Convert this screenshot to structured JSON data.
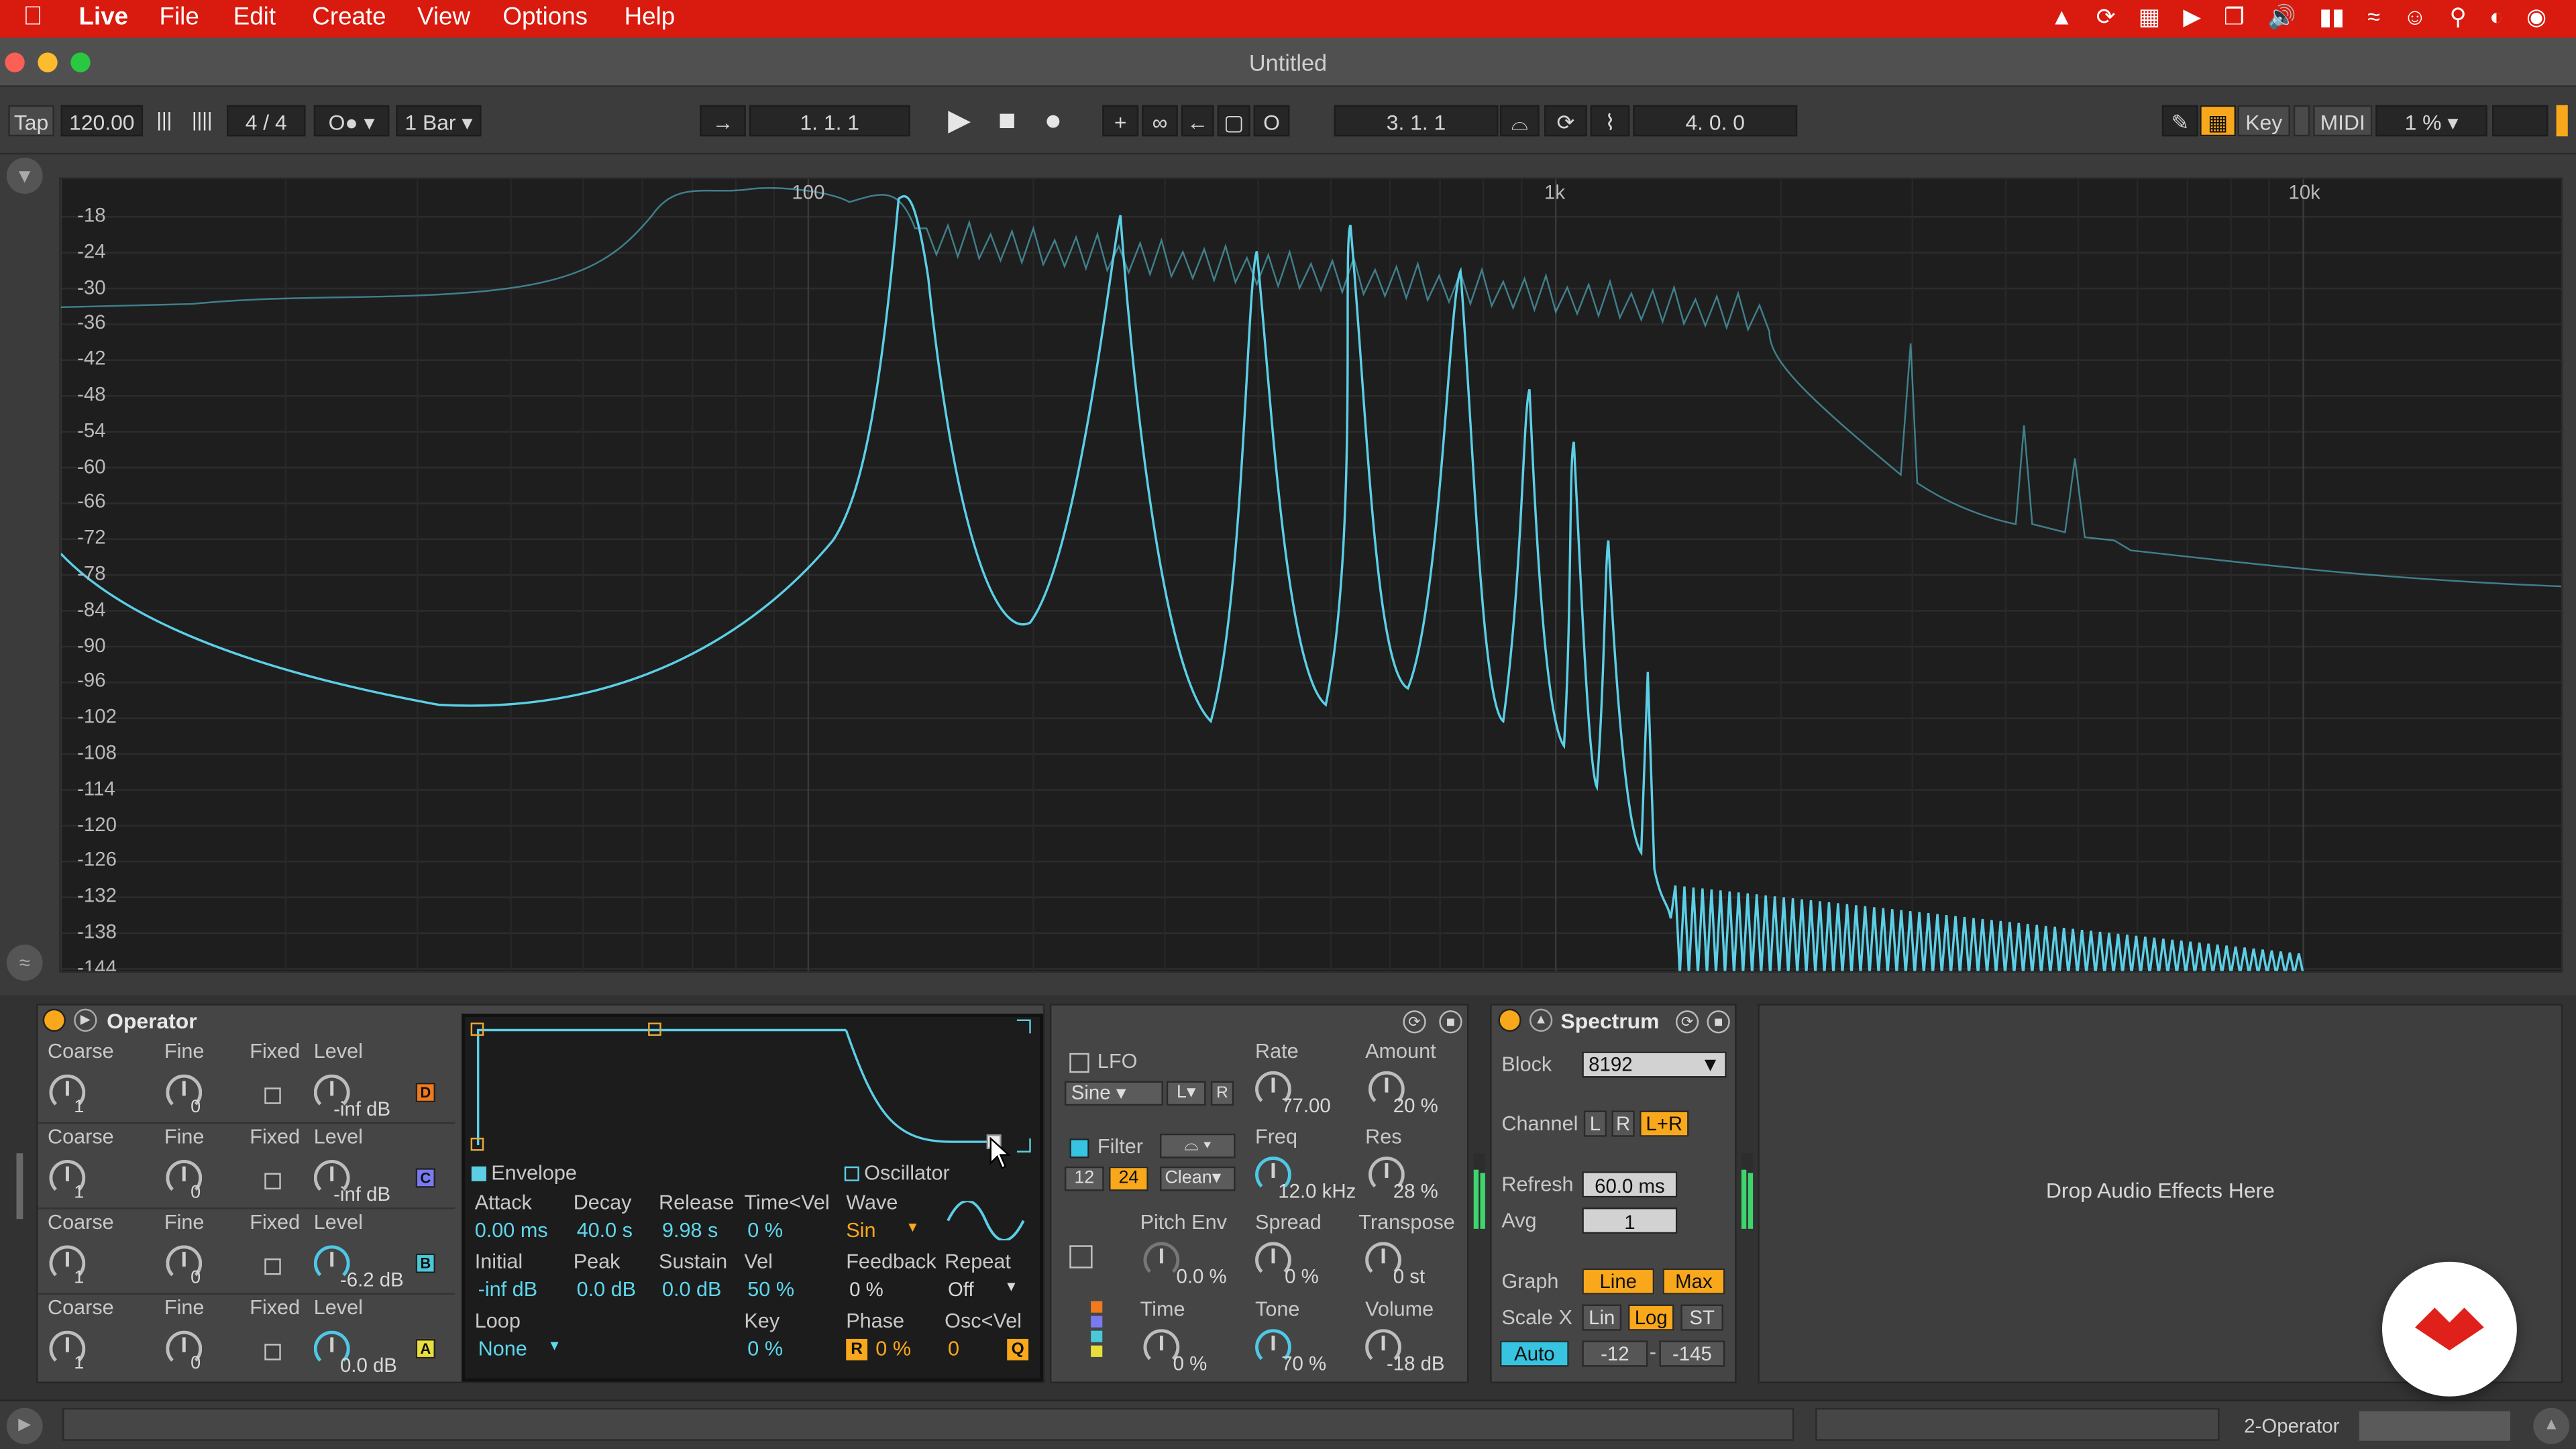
{
  "menubar": {
    "app": "Live",
    "menus": [
      "File",
      "Edit",
      "Create",
      "View",
      "Options",
      "Help"
    ]
  },
  "window": {
    "title": "Untitled"
  },
  "transport": {
    "tap": "Tap",
    "tempo": "120.00",
    "signature": "4 / 4",
    "quantize": "1 Bar",
    "arrangement_position": "1.  1.  1",
    "loop_start": "3.  1.  1",
    "loop_length": "4.  0.  0",
    "key_label": "Key",
    "midi_label": "MIDI",
    "cpu": "1 %"
  },
  "spectrum_display": {
    "y_labels": [
      "-18",
      "-24",
      "-30",
      "-36",
      "-42",
      "-48",
      "-54",
      "-60",
      "-66",
      "-72",
      "-78",
      "-84",
      "-90",
      "-96",
      "-102",
      "-108",
      "-114",
      "-120",
      "-126",
      "-132",
      "-138",
      "-144"
    ],
    "x_labels": [
      "100",
      "1k",
      "10k"
    ],
    "line_color": "#5ccfe6"
  },
  "operator": {
    "title": "Operator",
    "rows": [
      {
        "coarse_label": "Coarse",
        "fine_label": "Fine",
        "fixed_label": "Fixed",
        "level_label": "Level",
        "coarse": "1",
        "fine": "0",
        "level": "-inf dB",
        "osc": "D",
        "osc_color": "#f07a1d"
      },
      {
        "coarse_label": "Coarse",
        "fine_label": "Fine",
        "fixed_label": "Fixed",
        "level_label": "Level",
        "coarse": "1",
        "fine": "0",
        "level": "-inf dB",
        "osc": "C",
        "osc_color": "#7a7af0"
      },
      {
        "coarse_label": "Coarse",
        "fine_label": "Fine",
        "fixed_label": "Fixed",
        "level_label": "Level",
        "coarse": "1",
        "fine": "0",
        "level": "-6.2 dB",
        "osc": "B",
        "osc_color": "#49c8d8"
      },
      {
        "coarse_label": "Coarse",
        "fine_label": "Fine",
        "fixed_label": "Fixed",
        "level_label": "Level",
        "coarse": "1",
        "fine": "0",
        "level": "0.0 dB",
        "osc": "A",
        "osc_color": "#e9df3c"
      }
    ],
    "envelope": {
      "label": "Envelope",
      "attack_label": "Attack",
      "attack": "0.00 ms",
      "decay_label": "Decay",
      "decay": "40.0 s",
      "release_label": "Release",
      "release": "9.98 s",
      "timevel_label": "Time<Vel",
      "timevel": "0 %",
      "initial_label": "Initial",
      "initial": "-inf dB",
      "peak_label": "Peak",
      "peak": "0.0 dB",
      "sustain_label": "Sustain",
      "sustain": "0.0 dB",
      "vel_label": "Vel",
      "vel": "50 %",
      "loop_label": "Loop",
      "loop": "None",
      "key_label": "Key",
      "key": "0 %"
    },
    "oscillator": {
      "label": "Oscillator",
      "wave_label": "Wave",
      "wave": "Sin",
      "feedback_label": "Feedback",
      "feedback": "0 %",
      "repeat_label": "Repeat",
      "repeat": "Off",
      "phase_label": "Phase",
      "phase_r": "R",
      "phase": "0 %",
      "oscvel_label": "Osc<Vel",
      "oscvel": "0",
      "oscvel_q": "Q"
    },
    "lfo": {
      "label": "LFO",
      "wave": "Sine",
      "dest": "L",
      "r": "R",
      "rate_label": "Rate",
      "rate": "77.00",
      "amount_label": "Amount",
      "amount": "20 %"
    },
    "filter": {
      "label": "Filter",
      "slope12": "12",
      "slope24": "24",
      "circuit": "Clean",
      "freq_label": "Freq",
      "freq": "12.0 kHz",
      "res_label": "Res",
      "res": "28 %"
    },
    "pitch": {
      "pitchenv_label": "Pitch Env",
      "pitchenv": "0.0 %",
      "spread_label": "Spread",
      "spread": "0 %",
      "transpose_label": "Transpose",
      "transpose": "0 st"
    },
    "global": {
      "time_label": "Time",
      "time": "0 %",
      "tone_label": "Tone",
      "tone": "70 %",
      "volume_label": "Volume",
      "volume": "-18 dB"
    }
  },
  "spectrum": {
    "title": "Spectrum",
    "block_label": "Block",
    "block": "8192",
    "channel_label": "Channel",
    "channel_l": "L",
    "channel_r": "R",
    "channel_lr": "L+R",
    "refresh_label": "Refresh",
    "refresh": "60.0 ms",
    "avg_label": "Avg",
    "avg": "1",
    "graph_label": "Graph",
    "graph_line": "Line",
    "graph_max": "Max",
    "scalex_label": "Scale X",
    "scalex_lin": "Lin",
    "scalex_log": "Log",
    "scalex_st": "ST",
    "auto": "Auto",
    "range_low": "-12",
    "range_high": "-145"
  },
  "drop_zone": {
    "text": "Drop Audio Effects Here"
  },
  "bottom": {
    "track_name": "2-Operator"
  }
}
